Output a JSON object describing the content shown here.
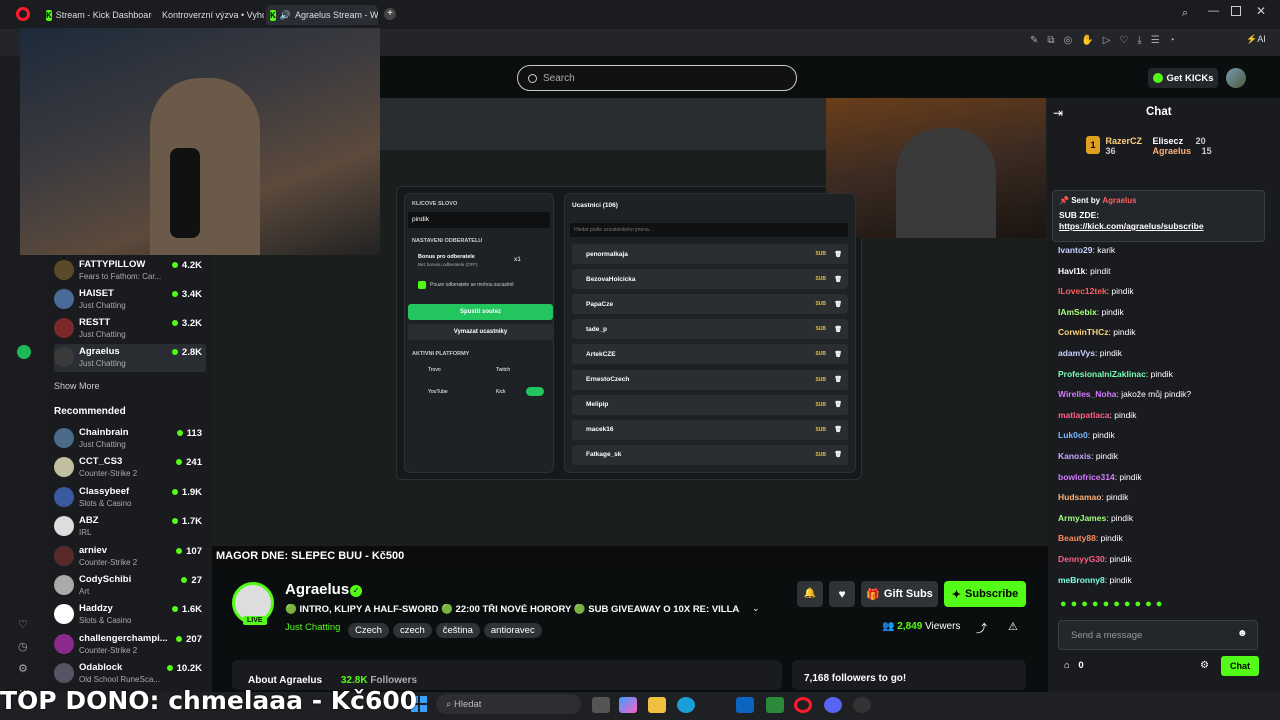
{
  "tabs": [
    {
      "label": "Stream - Kick Dashboard"
    },
    {
      "label": "Kontroverzní výzva • Vyho"
    },
    {
      "label": "Agraelus Stream - Wat"
    }
  ],
  "search": {
    "placeholder": "Search"
  },
  "header": {
    "get_kicks": "Get KICKs"
  },
  "followed": [
    {
      "name": "FATTYPILLOW",
      "category": "Fears to Fathom: Car...",
      "viewers": "4.2K"
    },
    {
      "name": "HAISET",
      "category": "Just Chatting",
      "viewers": "3.4K"
    },
    {
      "name": "RESTT",
      "category": "Just Chatting",
      "viewers": "3.2K"
    },
    {
      "name": "Agraelus",
      "category": "Just Chatting",
      "viewers": "2.8K"
    }
  ],
  "show_more": "Show More",
  "recommended_title": "Recommended",
  "recommended": [
    {
      "name": "Chainbrain",
      "category": "Just Chatting",
      "viewers": "113"
    },
    {
      "name": "CCT_CS3",
      "category": "Counter-Strike 2",
      "viewers": "241"
    },
    {
      "name": "Classybeef",
      "category": "Slots & Casino",
      "viewers": "1.9K"
    },
    {
      "name": "ABZ",
      "category": "IRL",
      "viewers": "1.7K"
    },
    {
      "name": "arniev",
      "category": "Counter-Strike 2",
      "viewers": "107"
    },
    {
      "name": "CodySchibi",
      "category": "Art",
      "viewers": "27"
    },
    {
      "name": "Haddzy",
      "category": "Slots & Casino",
      "viewers": "1.6K"
    },
    {
      "name": "challengerchampi...",
      "category": "Counter-Strike 2",
      "viewers": "207"
    },
    {
      "name": "Odablock",
      "category": "Old School RuneSca...",
      "viewers": "10.2K"
    }
  ],
  "giveaway": {
    "keyword_label": "KLICOVE SLOVO",
    "keyword_value": "pindik",
    "sub_settings": "NASTAVENI ODBERATELU",
    "bonus": "Bonus pro odberatele",
    "bonus_sub": "Bez bonusu odberatele (OFF)",
    "multiplier": "x1",
    "subs_only": "Pouze odberatele se mohou zucastnit",
    "start": "Spustit soutez",
    "clear": "Vymazat ucastniky",
    "platforms_label": "AKTIVNI PLATFORMY",
    "platforms": [
      "Trovo",
      "Twitch",
      "YouTube",
      "Kick"
    ],
    "participants_label": "Ucastnici (106)",
    "search_placeholder": "Hledat podle uzivatelskeho jmena...",
    "participants": [
      "penormalkaja",
      "BezovaHolcicka",
      "PapaCze",
      "tade_p",
      "ArtekCZE",
      "ErnestoCzech",
      "Melipip",
      "macek16",
      "Fatkage_sk"
    ],
    "sub_badge": "SUB"
  },
  "ticker": {
    "text": "MAGOR DNE: SLEPEC  BUU - Kč500"
  },
  "stream": {
    "name": "Agraelus",
    "live": "LIVE",
    "title": "🟢 INTRO, KLIPY A HALF-SWORD 🟢 22:00 TŘI NOVÉ HORORY 🟢 SUB GIVEAWAY O 10X RE: VILLA...",
    "category": "Just Chatting",
    "tags": [
      "Czech",
      "czech",
      "čeština",
      "antioravec"
    ],
    "viewers": "2,849",
    "viewers_label": "Viewers",
    "gift_subs": "Gift Subs",
    "subscribe": "Subscribe",
    "about": "About Agraelus",
    "followers": "32.8K",
    "followers_label": "Followers",
    "followers_goal": "7,168 followers to go!"
  },
  "chat": {
    "title": "Chat",
    "leaderboard": [
      {
        "name": "RazerCZ",
        "value": "36"
      },
      {
        "name": "Elisecz",
        "value": "20"
      },
      {
        "name": "Agraelus",
        "value": "15"
      }
    ],
    "pinned": {
      "sent_by": "Sent by",
      "author": "Agraelus",
      "line1": "SUB ZDE:",
      "link": "https://kick.com/agraelus/subscribe"
    },
    "messages": [
      {
        "user": "Ivanto29",
        "text": "karik",
        "color": "#c7d2ff"
      },
      {
        "user": "Havl1k",
        "text": "pindit",
        "color": "#ffffff"
      },
      {
        "user": "ILovec12tek",
        "text": "pindik",
        "color": "#ff5e5e"
      },
      {
        "user": "IAmSebix",
        "text": "pindik",
        "color": "#a6ff7a"
      },
      {
        "user": "CorwinTHCz",
        "text": "pindik",
        "color": "#ffd27a"
      },
      {
        "user": "adamVys",
        "text": "pindik",
        "color": "#c7d2ff"
      },
      {
        "user": "ProfesionalniZaklinac",
        "text": "pindik",
        "color": "#7affb2"
      },
      {
        "user": "Wirelles_Noha",
        "text": "jakože můj pindik?",
        "color": "#d47aff"
      },
      {
        "user": "matlapatlaca",
        "text": "pindik",
        "color": "#ff5e8a"
      },
      {
        "user": "Luk0o0",
        "text": "pindik",
        "color": "#7ab8ff"
      },
      {
        "user": "Kanoxis",
        "text": "pindik",
        "color": "#c7a6ff"
      },
      {
        "user": "bowlofrice314",
        "text": "pindik",
        "color": "#d47aff"
      },
      {
        "user": "Hudsamao",
        "text": "pindik",
        "color": "#ffb27a"
      },
      {
        "user": "ArmyJames",
        "text": "pindik",
        "color": "#a6ff7a"
      },
      {
        "user": "Beauty88",
        "text": "pindik",
        "color": "#ff8a5e"
      },
      {
        "user": "DennyyG30",
        "text": "pindik",
        "color": "#ff5e8a"
      },
      {
        "user": "meBronny8",
        "text": "pindik",
        "color": "#7affe0"
      }
    ],
    "input_placeholder": "Send a message",
    "kicks": "0",
    "send": "Chat"
  },
  "taskbar": {
    "search": "Hledat"
  },
  "overlay": {
    "top_dono": "TOP DONO: chmelaaa - Kč600"
  },
  "colors": {
    "accent": "#53fc18",
    "bg": "#0b0e0f",
    "panel": "#191b1f"
  }
}
